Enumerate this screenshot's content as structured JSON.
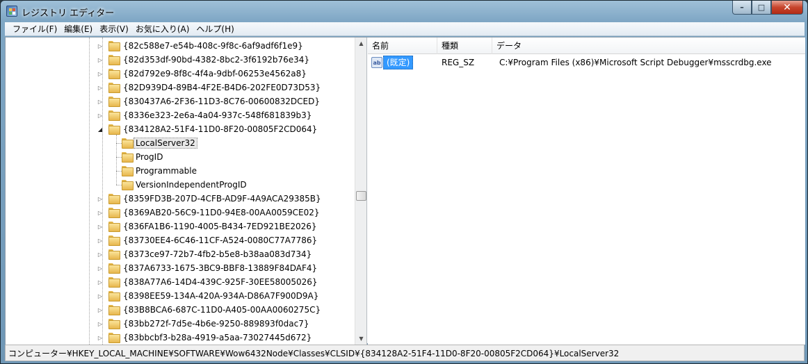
{
  "window": {
    "title": "レジストリ エディター"
  },
  "menu": [
    "ファイル(F)",
    "編集(E)",
    "表示(V)",
    "お気に入り(A)",
    "ヘルプ(H)"
  ],
  "tree": {
    "nodes": [
      {
        "label": "{82c588e7-e54b-408c-9f8c-6af9adf6f1e9}",
        "level": 1,
        "expander": "closed"
      },
      {
        "label": "{82d353df-90bd-4382-8bc2-3f6192b76e34}",
        "level": 1,
        "expander": "closed"
      },
      {
        "label": "{82d792e9-8f8c-4f4a-9dbf-06253e4562a8}",
        "level": 1,
        "expander": "closed"
      },
      {
        "label": "{82D939D4-89B4-4F2E-B4D6-202FE0D73D53}",
        "level": 1,
        "expander": "closed"
      },
      {
        "label": "{830437A6-2F36-11D3-8C76-00600832DCED}",
        "level": 1,
        "expander": "closed"
      },
      {
        "label": "{8336e323-2e6a-4a04-937c-548f681839b3}",
        "level": 1,
        "expander": "closed"
      },
      {
        "label": "{834128A2-51F4-11D0-8F20-00805F2CD064}",
        "level": 1,
        "expander": "open"
      },
      {
        "label": "LocalServer32",
        "level": 2,
        "expander": "none",
        "selected": true
      },
      {
        "label": "ProgID",
        "level": 2,
        "expander": "none"
      },
      {
        "label": "Programmable",
        "level": 2,
        "expander": "none"
      },
      {
        "label": "VersionIndependentProgID",
        "level": 2,
        "expander": "none"
      },
      {
        "label": "{8359FD3B-207D-4CFB-AD9F-4A9ACA29385B}",
        "level": 1,
        "expander": "closed"
      },
      {
        "label": "{8369AB20-56C9-11D0-94E8-00AA0059CE02}",
        "level": 1,
        "expander": "closed"
      },
      {
        "label": "{836FA1B6-1190-4005-B434-7ED921BE2026}",
        "level": 1,
        "expander": "closed"
      },
      {
        "label": "{83730EE4-6C46-11CF-A524-0080C77A7786}",
        "level": 1,
        "expander": "closed"
      },
      {
        "label": "{8373ce97-72b7-4fb2-b5e8-b38aa083d734}",
        "level": 1,
        "expander": "closed"
      },
      {
        "label": "{837A6733-1675-3BC9-BBF8-13889F84DAF4}",
        "level": 1,
        "expander": "closed"
      },
      {
        "label": "{838A77A6-14D4-439C-925F-30EE58005026}",
        "level": 1,
        "expander": "closed"
      },
      {
        "label": "{8398EE59-134A-420A-934A-D86A7F900D9A}",
        "level": 1,
        "expander": "closed"
      },
      {
        "label": "{83B8BCA6-687C-11D0-A405-00AA0060275C}",
        "level": 1,
        "expander": "closed"
      },
      {
        "label": "{83bb272f-7d5e-4b6e-9250-889893f0dac7}",
        "level": 1,
        "expander": "closed"
      },
      {
        "label": "{83bbcbf3-b28a-4919-a5aa-73027445d672}",
        "level": 1,
        "expander": "closed"
      }
    ]
  },
  "list": {
    "columns": [
      "名前",
      "種類",
      "データ"
    ],
    "rows": [
      {
        "icon": "ab",
        "name": "(既定)",
        "type": "REG_SZ",
        "data": "C:¥Program Files (x86)¥Microsoft Script Debugger¥msscrdbg.exe"
      }
    ]
  },
  "status": {
    "path": "コンピューター¥HKEY_LOCAL_MACHINE¥SOFTWARE¥Wow6432Node¥Classes¥CLSID¥{834128A2-51F4-11D0-8F20-00805F2CD064}¥LocalServer32"
  }
}
